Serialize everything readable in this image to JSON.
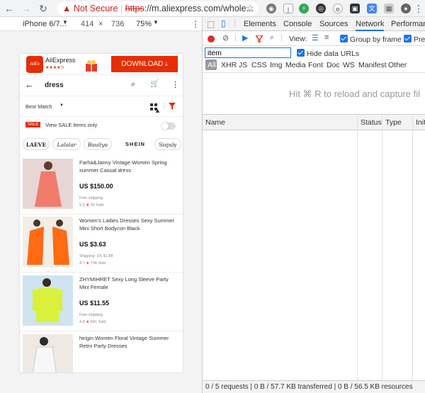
{
  "browser": {
    "security_label": "Not Secure",
    "url_https": "https",
    "url_rest": "://m.aliexpress.com/whole...",
    "star_icon": "star-icon"
  },
  "device_toolbar": {
    "device": "iPhone 6/7...",
    "width": "414",
    "times": "×",
    "height": "736",
    "zoom": "75%"
  },
  "app": {
    "banner": {
      "brand": "AliExpress",
      "rating": "★★★★½",
      "download_label": "DOWNLOAD"
    },
    "search": {
      "query": "dress"
    },
    "sort": {
      "label": "Best Match"
    },
    "sale": {
      "badge": "SALE",
      "text": "View SALE items only"
    },
    "brands": [
      "LAEVE",
      "Lalalar",
      "Bauliya",
      "SHEIN",
      "Sisjuly"
    ],
    "products": [
      {
        "title": "Farha&Janny Vintage Women Spring summer Casual dress",
        "price": "US $150.00",
        "shipping": "Free shipping",
        "rating": "5.0",
        "sold": "30 Sold"
      },
      {
        "title": "Women's Ladies Dresses Sexy Summer Mini Short Bodycon Black",
        "price": "US $3.63",
        "shipping": "Shipping: US $1.88",
        "rating": "4.7",
        "sold": "734 Sold"
      },
      {
        "title": "ZHYMIHRET Sexy Long Sleeve Party Mini Female",
        "price": "US $11.55",
        "shipping": "Free shipping",
        "rating": "4.8",
        "sold": "591 Sold"
      },
      {
        "title": "hirigin Women Floral Vintage Summer Retro Party Dresses",
        "price": "",
        "shipping": "",
        "rating": "",
        "sold": ""
      }
    ]
  },
  "devtools": {
    "tabs": [
      "Elements",
      "Console",
      "Sources",
      "Network",
      "Performance"
    ],
    "active_tab": "Network",
    "view_label": "View:",
    "group_by_frame": "Group by frame",
    "preserve_log": "Pres",
    "filter_value": "item",
    "hide_data_urls": "Hide data URLs",
    "types": [
      "All",
      "XHR",
      "JS",
      "CSS",
      "Img",
      "Media",
      "Font",
      "Doc",
      "WS",
      "Manifest",
      "Other"
    ],
    "empty_hint": "Hit ⌘ R to reload and capture fil",
    "columns": [
      "Name",
      "Status",
      "Type",
      "Initi"
    ],
    "status_bar": "0 / 5 requests | 0 B / 57.7 KB transferred | 0 B / 56.5 KB resources",
    "colors": {
      "accent": "#1a73e8",
      "record": "#d93025"
    }
  }
}
